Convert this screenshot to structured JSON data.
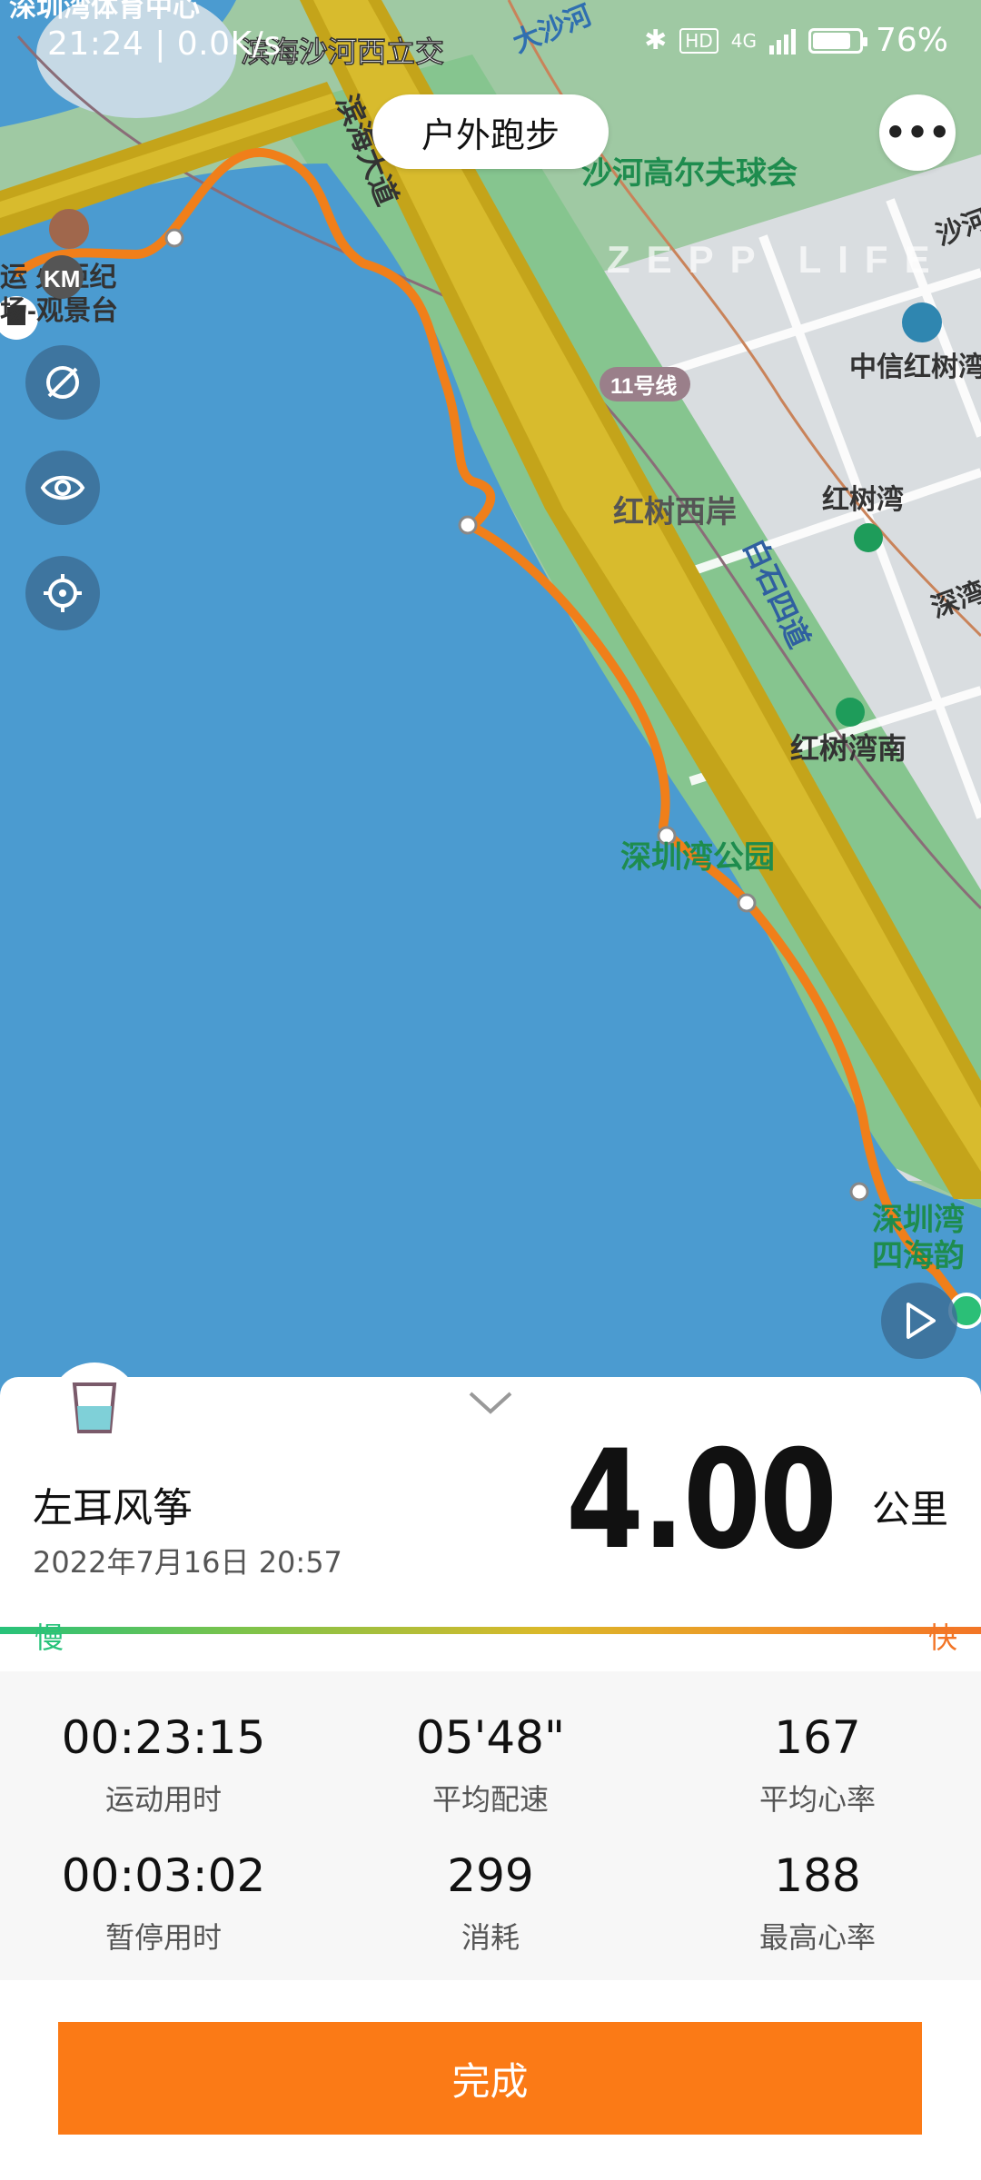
{
  "status_bar": {
    "time_speed": "21:24 | 0.0K/s",
    "hd": "HD",
    "network": "4G",
    "battery": "76%",
    "battery_level": 0.76
  },
  "header": {
    "title": "户外跑步",
    "more_label": "•••"
  },
  "map": {
    "labels": {
      "top_left": "深圳湾体育中心",
      "interchange": "滨海沙河西立交",
      "dasha": "大沙河",
      "golf": "沙河高尔夫球会",
      "road": "滨海大道",
      "logo": "ZEPP LIFE",
      "citic": "中信红树湾",
      "metro_line": "11号线",
      "west_shore": "红树西岸",
      "hongshuwan": "红树湾",
      "baishi": "白石四道",
      "shenwan": "深湾",
      "hongshuwan_south": "红树湾南",
      "park": "深圳湾公园",
      "torch_1": "运 火炬纪",
      "torch_2": "场-观景台",
      "bay_1": "深圳湾",
      "bay_2": "四海韵",
      "shaking": "沙河",
      "km_marker": "KM"
    }
  },
  "summary": {
    "user": "左耳风筝",
    "datetime": "2022年7月16日 20:57",
    "distance": "4.00",
    "unit": "公里",
    "slow": "慢",
    "fast": "快"
  },
  "stats": [
    {
      "value": "00:23:15",
      "label": "运动用时"
    },
    {
      "value": "05'48\"",
      "label": "平均配速"
    },
    {
      "value": "167",
      "label": "平均心率"
    },
    {
      "value": "00:03:02",
      "label": "暂停用时"
    },
    {
      "value": "299",
      "label": "消耗"
    },
    {
      "value": "188",
      "label": "最高心率"
    }
  ],
  "finish_button": "完成"
}
